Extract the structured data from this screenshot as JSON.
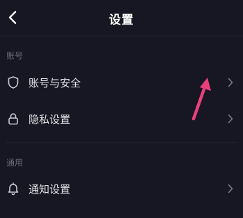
{
  "header": {
    "title": "设置",
    "back_icon": "chevron-left-icon"
  },
  "sections": [
    {
      "label": "账号",
      "items": [
        {
          "label": "账号与安全",
          "icon": "shield-icon"
        },
        {
          "label": "隐私设置",
          "icon": "lock-icon"
        }
      ]
    },
    {
      "label": "通用",
      "items": [
        {
          "label": "通知设置",
          "icon": "bell-icon"
        }
      ]
    }
  ],
  "colors": {
    "background": "#161722",
    "annotation_arrow": "#e8407a"
  }
}
